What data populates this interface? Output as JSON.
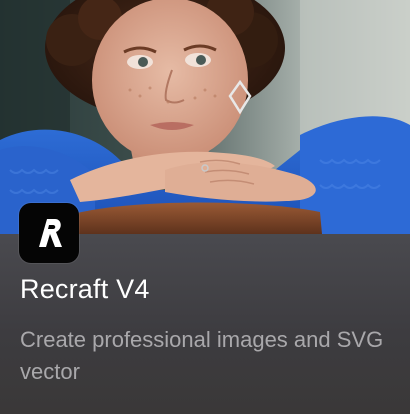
{
  "app": {
    "icon": "recraft-logo-icon",
    "name": "Recraft V4",
    "description": "Create professional images and SVG vector"
  },
  "hero": {
    "subject": "portrait-photo"
  }
}
